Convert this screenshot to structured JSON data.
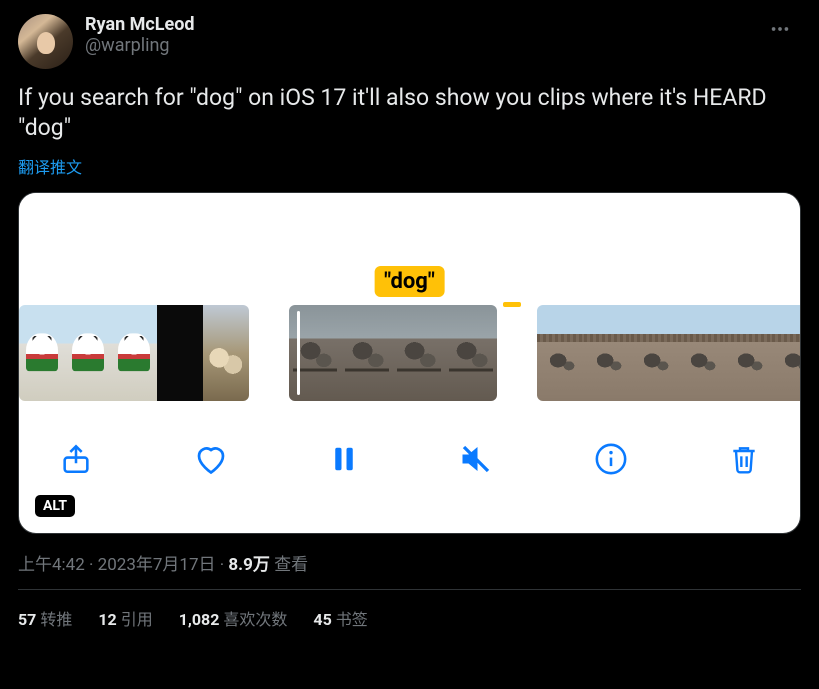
{
  "user": {
    "display_name": "Ryan McLeod",
    "handle": "@warpling"
  },
  "tweet_text": "If you search for \"dog\" on iOS 17 it'll also show you clips where it's HEARD \"dog\"",
  "translate_label": "翻译推文",
  "media": {
    "caption_label": "\"dog\"",
    "alt_badge": "ALT"
  },
  "meta": {
    "time": "上午4:42",
    "date": "2023年7月17日",
    "views_num": "8.9万",
    "views_label": "查看",
    "sep": " · "
  },
  "stats": {
    "retweets_num": "57",
    "retweets_label": "转推",
    "quotes_num": "12",
    "quotes_label": "引用",
    "likes_num": "1,082",
    "likes_label": "喜欢次数",
    "bookmarks_num": "45",
    "bookmarks_label": "书签"
  }
}
